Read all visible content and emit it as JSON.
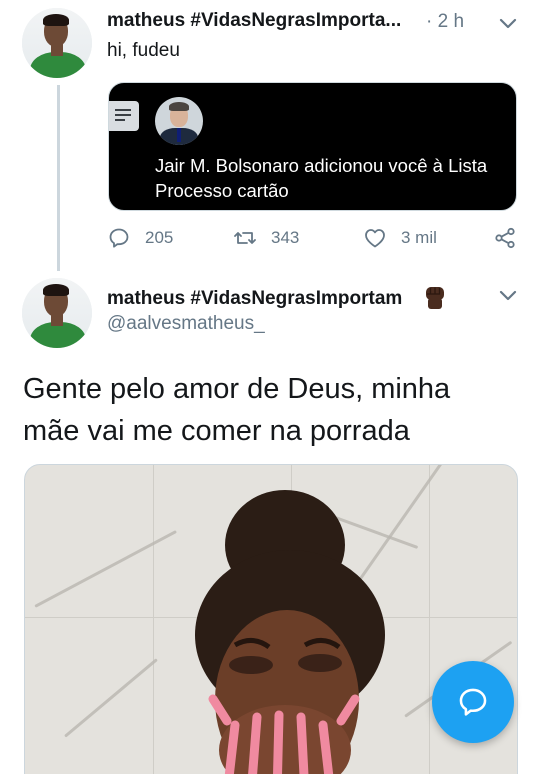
{
  "reply_tweet": {
    "display_name": "matheus #VidasNegrasImporta...",
    "time": "· 2 h",
    "text": "hi, fudeu",
    "card": {
      "icon": "document-icon",
      "text_line1": "Jair M. Bolsonaro adicionou você à Lista",
      "text_line2": "Processo cartão"
    },
    "actions": {
      "reply_count": "205",
      "retweet_count": "343",
      "like_count": "3 mil"
    }
  },
  "main_tweet": {
    "display_name": "matheus #VidasNegrasImportam",
    "emoji": "raised-fist-dark-skin",
    "handle": "@aalvesmatheus_",
    "text_line1": "Gente pelo amor de Deus, minha",
    "text_line2": "mãe vai me comer na porrada"
  },
  "colors": {
    "accent": "#1da1f2",
    "muted": "#657786",
    "thread_line": "#ccd6dd",
    "card_bg": "#000000"
  },
  "fab": {
    "icon": "compose-bubble-icon"
  }
}
